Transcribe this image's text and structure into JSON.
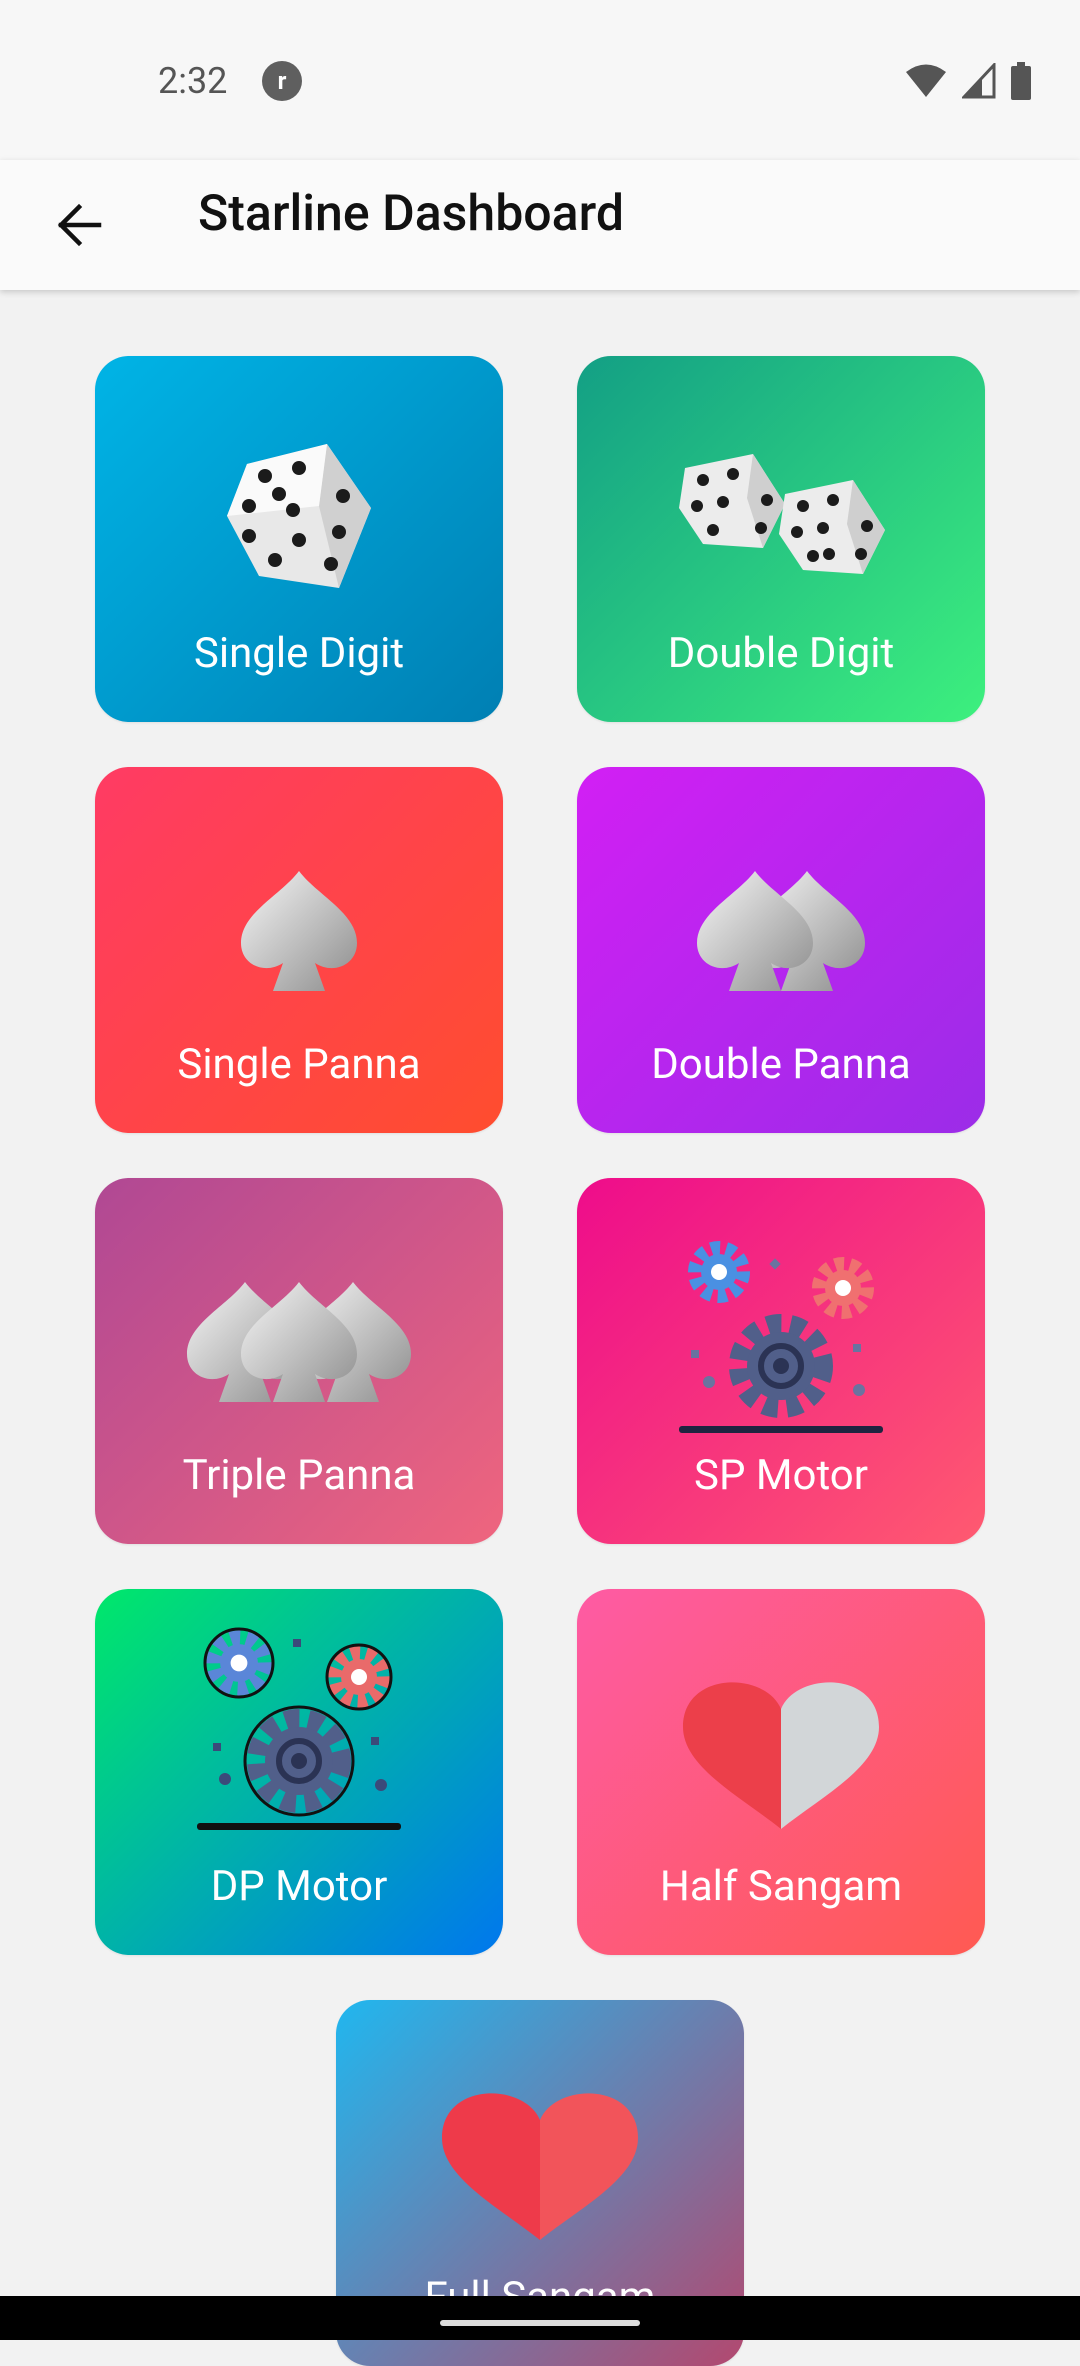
{
  "status_bar": {
    "time": "2:32",
    "notification_icon": "r"
  },
  "app_bar": {
    "title": "Starline Dashboard"
  },
  "tiles": [
    {
      "label": "Single Digit",
      "icon": "single-die-icon",
      "gradient": [
        "#00b4e6",
        "#007fb3"
      ]
    },
    {
      "label": "Double Digit",
      "icon": "double-dice-icon",
      "gradient": [
        "#139f85",
        "#3df07e"
      ]
    },
    {
      "label": "Single Panna",
      "icon": "single-spade-icon",
      "gradient": [
        "#ff3b64",
        "#ff4d2e"
      ]
    },
    {
      "label": "Double Panna",
      "icon": "double-spade-icon",
      "gradient": [
        "#d21ff4",
        "#9b2ce8"
      ]
    },
    {
      "label": "Triple Panna",
      "icon": "triple-spade-icon",
      "gradient": [
        "#b04894",
        "#ef657e"
      ]
    },
    {
      "label": "SP Motor",
      "icon": "gears-icon",
      "gradient": [
        "#ee0c8b",
        "#ff5a70"
      ]
    },
    {
      "label": "DP Motor",
      "icon": "gears-icon",
      "gradient": [
        "#00e86a",
        "#0077ee"
      ]
    },
    {
      "label": "Half Sangam",
      "icon": "half-heart-icon",
      "gradient": [
        "#fe5ba4",
        "#ff5a52"
      ]
    },
    {
      "label": "Full Sangam",
      "icon": "heart-icon",
      "gradient": [
        "#20b7ef",
        "#b3486f"
      ]
    }
  ]
}
